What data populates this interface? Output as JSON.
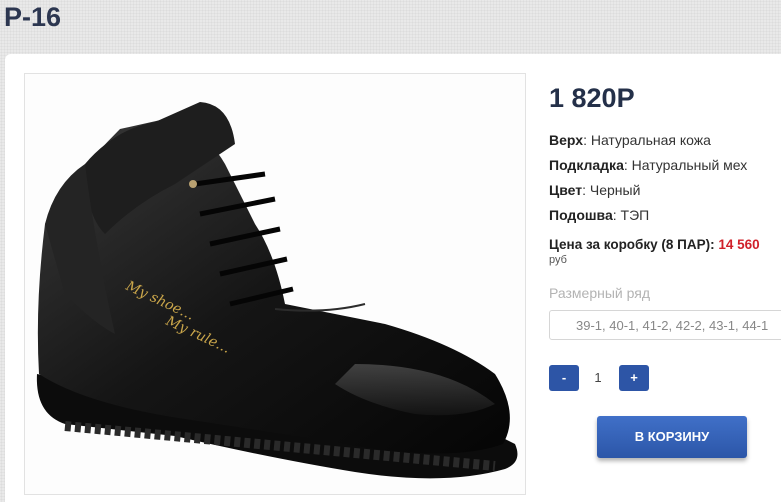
{
  "product": {
    "title": "P-16",
    "price": "1 820Р",
    "image_alt": "shoe-photo",
    "specs": [
      {
        "label": "Верх",
        "value": ": Натуральная кожа"
      },
      {
        "label": "Подкладка",
        "value": ": Натуральный мех"
      },
      {
        "label": "Цвет",
        "value": ": Черный"
      },
      {
        "label": "Подошва",
        "value": ": ТЭП"
      }
    ],
    "box_price_label": "Цена за коробку (8 ПАР): ",
    "box_price_value": "14 560",
    "box_price_currency": "руб",
    "size_label": "Размерный ряд",
    "size_value": "39-1, 40-1, 41-2, 42-2, 43-1, 44-1",
    "quantity": "1",
    "minus_label": "-",
    "plus_label": "+",
    "cart_button": "В КОРЗИНУ"
  },
  "colors": {
    "accent": "#2d55a6",
    "price_red": "#d0202a",
    "title": "#2c3650"
  }
}
